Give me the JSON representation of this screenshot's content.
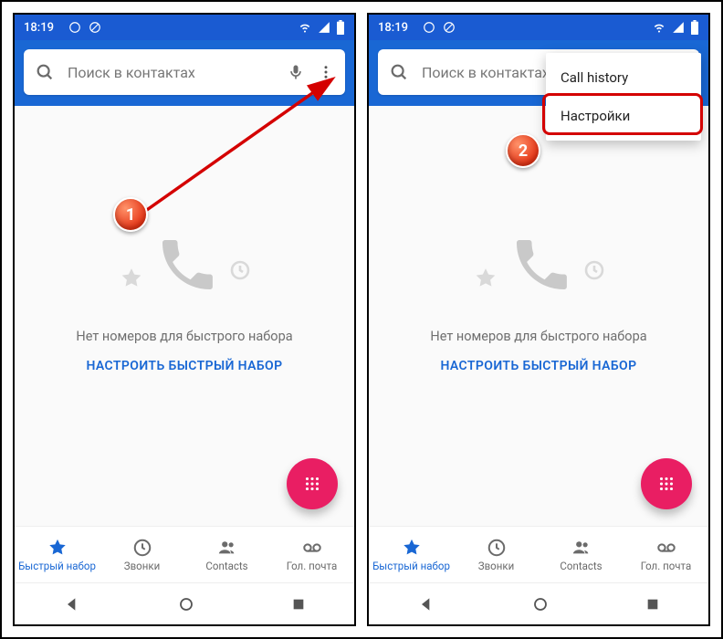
{
  "statusbar": {
    "time": "18:19"
  },
  "search": {
    "placeholder": "Поиск в контактах"
  },
  "empty": {
    "msg": "Нет номеров для быстрого набора",
    "cta": "НАСТРОИТЬ БЫСТРЫЙ НАБОР"
  },
  "tabs": {
    "speed": "Быстрый набор",
    "calls": "Звонки",
    "contacts": "Contacts",
    "voicemail": "Гол. почта"
  },
  "popup": {
    "call_history": "Call history",
    "settings": "Настройки"
  },
  "annotation": {
    "step1": "1",
    "step2": "2"
  }
}
